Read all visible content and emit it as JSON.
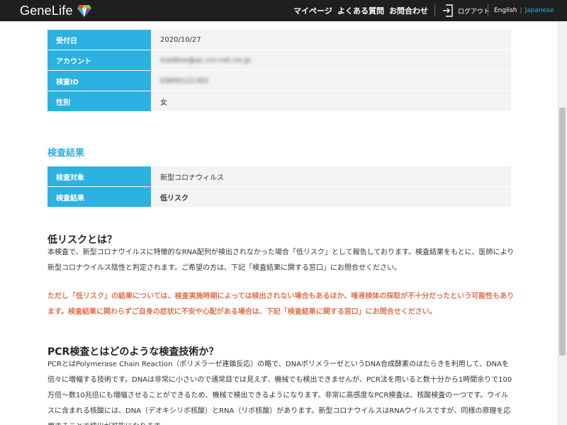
{
  "header": {
    "logo_text": "GeneLife",
    "nav": [
      "マイページ",
      "よくある質問",
      "お問合わせ"
    ],
    "logout_label": "ログアウト",
    "lang_en": "English",
    "lang_separator": "|",
    "lang_ja": "Japanese",
    "colors": {
      "bar": "#1f1f1f",
      "accent": "#2cb1e3"
    }
  },
  "account_table": [
    {
      "label": "受付日",
      "value": "2020/10/27"
    },
    {
      "label": "アカウント",
      "value": "mailbox@ac.cm-net.ne.jp"
    },
    {
      "label": "検査ID",
      "value": "GW00121302"
    },
    {
      "label": "性別",
      "value": "女"
    }
  ],
  "result_section": {
    "title": "検査結果",
    "rows": [
      {
        "label": "検査対象",
        "value": "新型コロナウィルス"
      },
      {
        "label": "検査結果",
        "value": "低リスク"
      }
    ]
  },
  "low_risk": {
    "heading": "低リスクとは？",
    "body": "本検査で、新型コロナウイルスに特徴的なRNA配列が検出されなかった場合「低リスク」として報告しております。検査結果をもとに、医師により新型コロナウイルス陰性と判定されます。ご希望の方は、下記「検査結果に関する窓口」にお問合せください。",
    "warning": "ただし「低リスク」の結果については、検査実施時期によっては検出されない場合もあるほか、唾液検体の採取が不十分だったという可能性もあります。検査結果に関わらずご自身の症状に不安や心配がある場合は、下記「検査結果に関する窓口」にお問合せください。"
  },
  "pcr": {
    "heading": "PCR検査とはどのような検査技術か？",
    "body": "PCRとはPolymerase Chain Reaction（ポリメラーゼ連鎖反応）の略で、DNAポリメラーゼというDNA合成酵素のはたらきを利用して、DNAを倍々に増幅する技術です。DNAは非常に小さいので通常目では見えず、機械でも検出できませんが、PCR法を用いると数十分から1時間余りで100万倍〜数10兆倍にも増幅させることができるため、機械で検出できるようになります。非常に高感度なPCR検査は、核酸検査の一つです。ウイルスに含まれる核酸には、DNA（デオキシリボ核酸）とRNA（リボ核酸）があります。新型コロナウイルスはRNAウイルスですが、同様の原理を応用することで検出が可能になります。"
  }
}
